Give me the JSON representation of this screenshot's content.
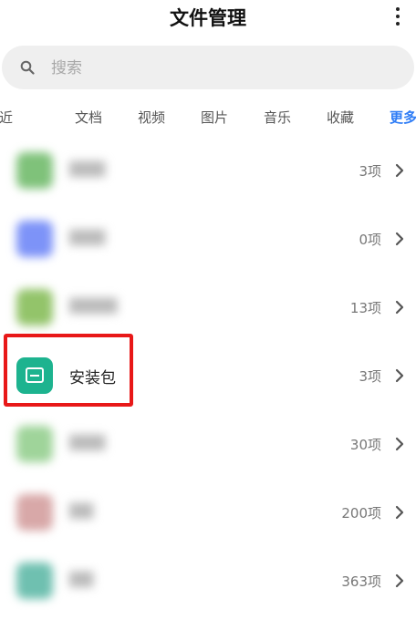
{
  "header": {
    "title": "文件管理"
  },
  "search": {
    "placeholder": "搜索"
  },
  "tabs": [
    {
      "label": "最近"
    },
    {
      "label": "文档"
    },
    {
      "label": "视频"
    },
    {
      "label": "图片"
    },
    {
      "label": "音乐"
    },
    {
      "label": "收藏"
    },
    {
      "label": "更多"
    }
  ],
  "list": [
    {
      "count": "3项",
      "icon_color": "#7fc27a"
    },
    {
      "count": "0项",
      "icon_color": "#7d93f8"
    },
    {
      "count": "13项",
      "icon_color": "#93c46a"
    },
    {
      "name": "安装包",
      "count": "3项",
      "icon_color": "#1db38f"
    },
    {
      "count": "30项",
      "icon_color": "#9fd49a"
    },
    {
      "count": "200项",
      "icon_color": "#d8a8a8"
    },
    {
      "count": "363项",
      "icon_color": "#6fc0b0"
    }
  ],
  "colors": {
    "accent": "#2f7df6",
    "highlight": "#e81818"
  }
}
